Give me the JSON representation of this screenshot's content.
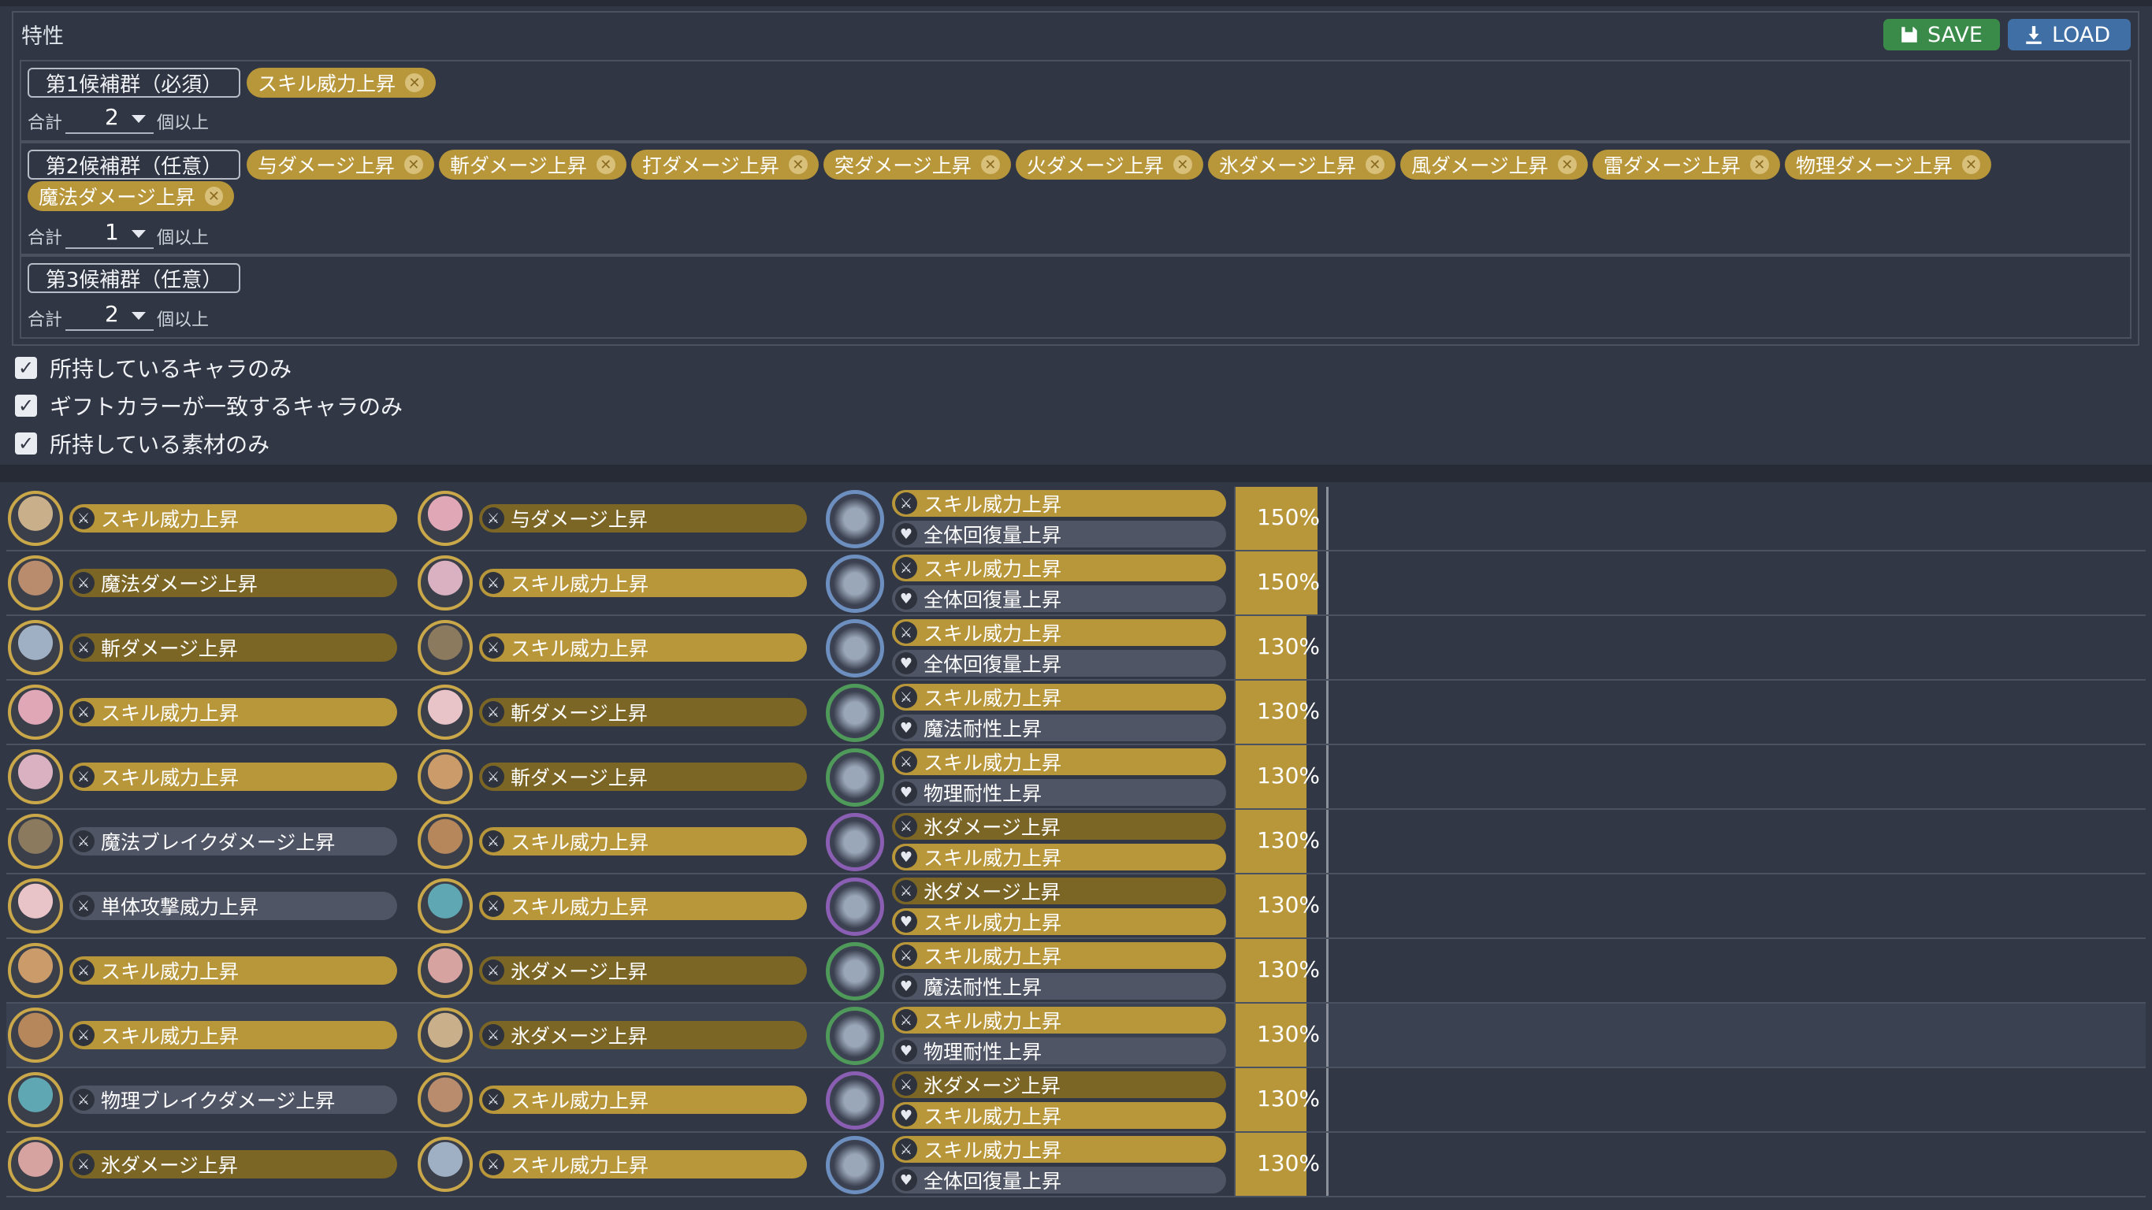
{
  "panel": {
    "title": "特性",
    "save_label": "SAVE",
    "load_label": "LOAD",
    "count_prefix": "合計",
    "count_suffix": "個以上"
  },
  "groups": [
    {
      "label": "第1候補群（必須）",
      "chips": [
        "スキル威力上昇"
      ],
      "count": "2"
    },
    {
      "label": "第2候補群（任意）",
      "chips": [
        "与ダメージ上昇",
        "斬ダメージ上昇",
        "打ダメージ上昇",
        "突ダメージ上昇",
        "火ダメージ上昇",
        "氷ダメージ上昇",
        "風ダメージ上昇",
        "雷ダメージ上昇",
        "物理ダメージ上昇",
        "魔法ダメージ上昇"
      ],
      "count": "1"
    },
    {
      "label": "第3候補群（任意）",
      "chips": [],
      "count": "2"
    }
  ],
  "checkboxes": [
    {
      "label": "所持しているキャラのみ",
      "checked": true
    },
    {
      "label": "ギフトカラーが一致するキャラのみ",
      "checked": true
    },
    {
      "label": "所持している素材のみ",
      "checked": true
    }
  ],
  "colors": {
    "gold": "#b8963a",
    "dark_gold": "#7c6626",
    "gray": "#4f5564",
    "save": "#3a8b49",
    "load": "#3f6fa5"
  },
  "rows": [
    {
      "c1": "スキル威力上昇",
      "c1s": "g",
      "c2": "与ダメージ上昇",
      "c2s": "d",
      "m1": "スキル威力上昇",
      "m1s": "g",
      "m2": "全体回復量上昇",
      "m2s": "n",
      "mat": "blue",
      "pct": "150%",
      "fill": 0.9
    },
    {
      "c1": "魔法ダメージ上昇",
      "c1s": "d",
      "c2": "スキル威力上昇",
      "c2s": "g",
      "m1": "スキル威力上昇",
      "m1s": "g",
      "m2": "全体回復量上昇",
      "m2s": "n",
      "mat": "blue",
      "pct": "150%",
      "fill": 0.9
    },
    {
      "c1": "斬ダメージ上昇",
      "c1s": "d",
      "c2": "スキル威力上昇",
      "c2s": "g",
      "m1": "スキル威力上昇",
      "m1s": "g",
      "m2": "全体回復量上昇",
      "m2s": "n",
      "mat": "blue",
      "pct": "130%",
      "fill": 0.78
    },
    {
      "c1": "スキル威力上昇",
      "c1s": "g",
      "c2": "斬ダメージ上昇",
      "c2s": "d",
      "m1": "スキル威力上昇",
      "m1s": "g",
      "m2": "魔法耐性上昇",
      "m2s": "n",
      "mat": "green",
      "pct": "130%",
      "fill": 0.78
    },
    {
      "c1": "スキル威力上昇",
      "c1s": "g",
      "c2": "斬ダメージ上昇",
      "c2s": "d",
      "m1": "スキル威力上昇",
      "m1s": "g",
      "m2": "物理耐性上昇",
      "m2s": "n",
      "mat": "green",
      "pct": "130%",
      "fill": 0.78
    },
    {
      "c1": "魔法ブレイクダメージ上昇",
      "c1s": "n",
      "c2": "スキル威力上昇",
      "c2s": "g",
      "m1": "氷ダメージ上昇",
      "m1s": "d",
      "m2": "スキル威力上昇",
      "m2s": "g",
      "mat": "purple",
      "pct": "130%",
      "fill": 0.78
    },
    {
      "c1": "単体攻撃威力上昇",
      "c1s": "n",
      "c2": "スキル威力上昇",
      "c2s": "g",
      "m1": "氷ダメージ上昇",
      "m1s": "d",
      "m2": "スキル威力上昇",
      "m2s": "g",
      "mat": "purple",
      "pct": "130%",
      "fill": 0.78
    },
    {
      "c1": "スキル威力上昇",
      "c1s": "g",
      "c2": "氷ダメージ上昇",
      "c2s": "d",
      "m1": "スキル威力上昇",
      "m1s": "g",
      "m2": "魔法耐性上昇",
      "m2s": "n",
      "mat": "green",
      "pct": "130%",
      "fill": 0.78
    },
    {
      "c1": "スキル威力上昇",
      "c1s": "g",
      "c2": "氷ダメージ上昇",
      "c2s": "d",
      "m1": "スキル威力上昇",
      "m1s": "g",
      "m2": "物理耐性上昇",
      "m2s": "n",
      "mat": "green",
      "pct": "130%",
      "fill": 0.78
    },
    {
      "c1": "物理ブレイクダメージ上昇",
      "c1s": "n",
      "c2": "スキル威力上昇",
      "c2s": "g",
      "m1": "氷ダメージ上昇",
      "m1s": "d",
      "m2": "スキル威力上昇",
      "m2s": "g",
      "mat": "purple",
      "pct": "130%",
      "fill": 0.78
    },
    {
      "c1": "氷ダメージ上昇",
      "c1s": "d",
      "c2": "スキル威力上昇",
      "c2s": "g",
      "m1": "スキル威力上昇",
      "m1s": "g",
      "m2": "全体回復量上昇",
      "m2s": "n",
      "mat": "blue",
      "pct": "130%",
      "fill": 0.78
    }
  ]
}
